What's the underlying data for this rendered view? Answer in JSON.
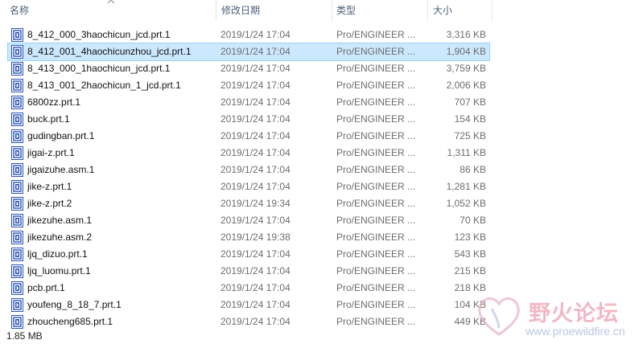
{
  "columns": {
    "name": "名称",
    "date": "修改日期",
    "type": "类型",
    "size": "大小"
  },
  "files": [
    {
      "name": "8_412_000_3haochicun_jcd.prt.1",
      "date": "2019/1/24 17:04",
      "type": "Pro/ENGINEER ...",
      "size": "3,316 KB"
    },
    {
      "name": "8_412_001_4haochicunzhou_jcd.prt.1",
      "date": "2019/1/24 17:04",
      "type": "Pro/ENGINEER ...",
      "size": "1,904 KB",
      "selected": true
    },
    {
      "name": "8_413_000_1haochicun_jcd.prt.1",
      "date": "2019/1/24 17:04",
      "type": "Pro/ENGINEER ...",
      "size": "3,759 KB"
    },
    {
      "name": "8_413_001_2haochicun_1_jcd.prt.1",
      "date": "2019/1/24 17:04",
      "type": "Pro/ENGINEER ...",
      "size": "2,006 KB"
    },
    {
      "name": "6800zz.prt.1",
      "date": "2019/1/24 17:04",
      "type": "Pro/ENGINEER ...",
      "size": "707 KB"
    },
    {
      "name": "buck.prt.1",
      "date": "2019/1/24 17:04",
      "type": "Pro/ENGINEER ...",
      "size": "154 KB"
    },
    {
      "name": "gudingban.prt.1",
      "date": "2019/1/24 17:04",
      "type": "Pro/ENGINEER ...",
      "size": "725 KB"
    },
    {
      "name": "jigai-z.prt.1",
      "date": "2019/1/24 17:04",
      "type": "Pro/ENGINEER ...",
      "size": "1,311 KB"
    },
    {
      "name": "jigaizuhe.asm.1",
      "date": "2019/1/24 17:04",
      "type": "Pro/ENGINEER ...",
      "size": "86 KB"
    },
    {
      "name": "jike-z.prt.1",
      "date": "2019/1/24 17:04",
      "type": "Pro/ENGINEER ...",
      "size": "1,281 KB"
    },
    {
      "name": "jike-z.prt.2",
      "date": "2019/1/24 19:34",
      "type": "Pro/ENGINEER ...",
      "size": "1,052 KB"
    },
    {
      "name": "jikezuhe.asm.1",
      "date": "2019/1/24 17:04",
      "type": "Pro/ENGINEER ...",
      "size": "70 KB"
    },
    {
      "name": "jikezuhe.asm.2",
      "date": "2019/1/24 19:38",
      "type": "Pro/ENGINEER ...",
      "size": "123 KB"
    },
    {
      "name": "ljq_dizuo.prt.1",
      "date": "2019/1/24 17:04",
      "type": "Pro/ENGINEER ...",
      "size": "543 KB"
    },
    {
      "name": "ljq_luomu.prt.1",
      "date": "2019/1/24 17:04",
      "type": "Pro/ENGINEER ...",
      "size": "215 KB"
    },
    {
      "name": "pcb.prt.1",
      "date": "2019/1/24 17:04",
      "type": "Pro/ENGINEER ...",
      "size": "218 KB"
    },
    {
      "name": "youfeng_8_18_7.prt.1",
      "date": "2019/1/24 17:04",
      "type": "Pro/ENGINEER ...",
      "size": "104 KB"
    },
    {
      "name": "zhoucheng685.prt.1",
      "date": "2019/1/24 17:04",
      "type": "Pro/ENGINEER ...",
      "size": "449 KB"
    }
  ],
  "file_icon": "proengineer-file-icon",
  "status": {
    "selection_size": "1.85 MB"
  },
  "watermark": {
    "text": "野火论坛",
    "url": "www.proewildfire.cn",
    "logo_icon": "heart-logo-icon"
  },
  "colors": {
    "selected_bg": "#cce8ff",
    "selected_border": "#99d1ff",
    "header_text": "#4c607a",
    "icon_blue": "#2b56b8"
  }
}
